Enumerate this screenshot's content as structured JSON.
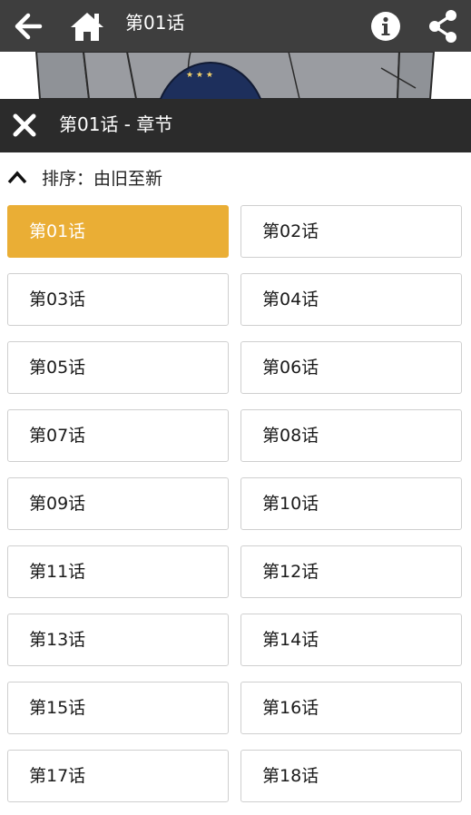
{
  "app_bar": {
    "title": "第01话",
    "icons": [
      "back-arrow-icon",
      "home-icon",
      "info-icon",
      "share-icon"
    ]
  },
  "chapter_panel": {
    "title": "第01话 - 章节",
    "sort_label": "排序：由旧至新",
    "active_chapter": "第01话",
    "accent_color": "#eaae35",
    "chapters": [
      "第01话",
      "第02话",
      "第03话",
      "第04话",
      "第05话",
      "第06话",
      "第07话",
      "第08话",
      "第09话",
      "第10话",
      "第11话",
      "第12话",
      "第13话",
      "第14话",
      "第15话",
      "第16话",
      "第17话",
      "第18话"
    ]
  }
}
